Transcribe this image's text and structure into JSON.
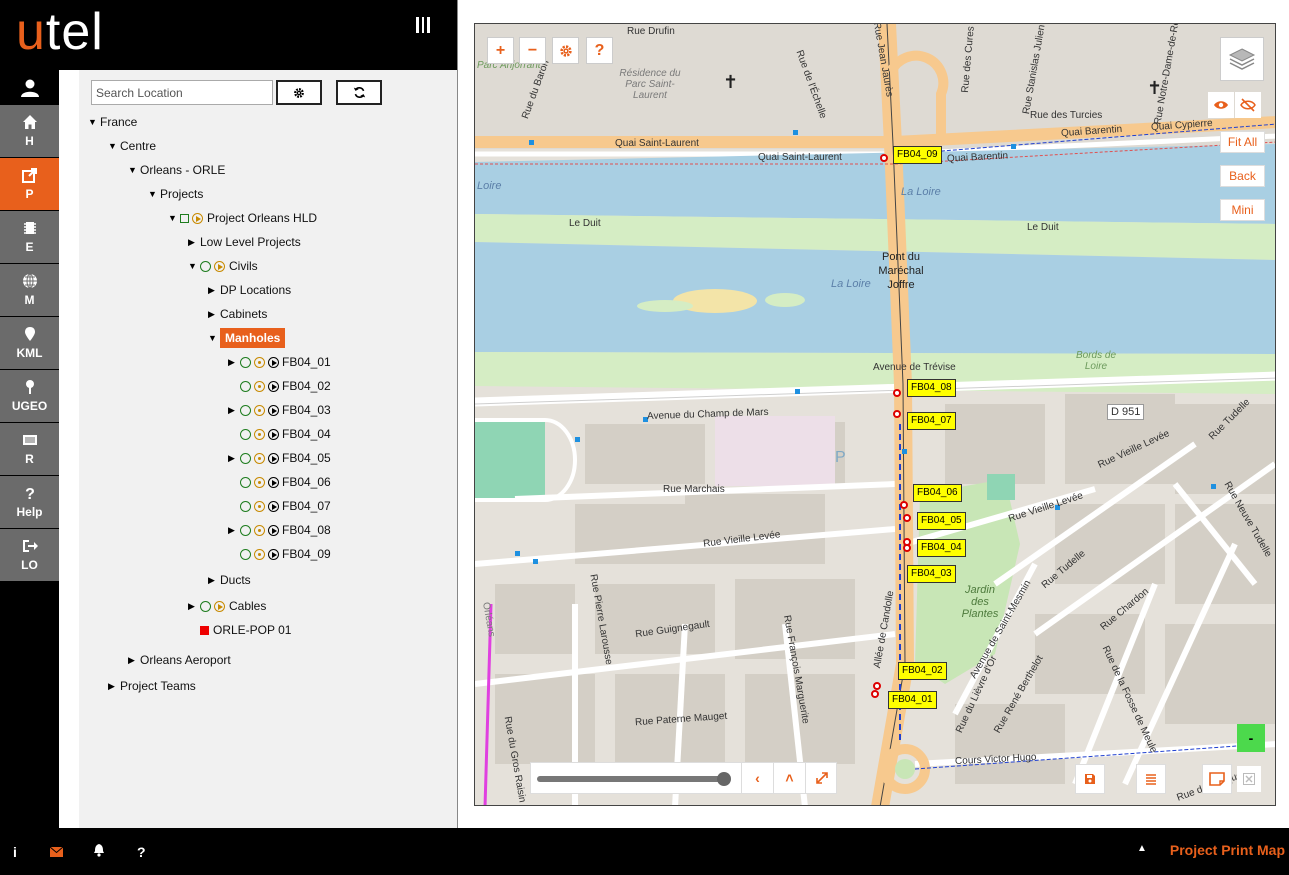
{
  "brand": {
    "logo_u": "u",
    "logo_rest": "tel"
  },
  "nav": {
    "items": [
      {
        "label": "H",
        "icon": "home-icon"
      },
      {
        "label": "P",
        "icon": "share-icon"
      },
      {
        "label": "E",
        "icon": "chip-icon"
      },
      {
        "label": "M",
        "icon": "globe-icon"
      },
      {
        "label": "KML",
        "icon": "pin-icon"
      },
      {
        "label": "UGEO",
        "icon": "map-pin-icon"
      },
      {
        "label": "R",
        "icon": "report-icon"
      },
      {
        "label": "Help",
        "icon": "help-icon"
      },
      {
        "label": "LO",
        "icon": "logout-icon"
      }
    ],
    "active": "P"
  },
  "search": {
    "placeholder": "Search Location"
  },
  "tree": {
    "france": "France",
    "centre": "Centre",
    "orleans_orle": "Orleans - ORLE",
    "projects": "Projects",
    "project_hld": "Project Orleans HLD",
    "low_level": "Low Level Projects",
    "civils": "Civils",
    "dp_locations": "DP Locations",
    "cabinets": "Cabinets",
    "manholes": "Manholes",
    "fb04_01": "FB04_01",
    "fb04_02": "FB04_02",
    "fb04_03": "FB04_03",
    "fb04_04": "FB04_04",
    "fb04_05": "FB04_05",
    "fb04_06": "FB04_06",
    "fb04_07": "FB04_07",
    "fb04_08": "FB04_08",
    "fb04_09": "FB04_09",
    "ducts": "Ducts",
    "cables": "Cables",
    "orle_pop": "ORLE-POP 01",
    "orleans_aeroport": "Orleans Aeroport",
    "project_teams": "Project Teams"
  },
  "map": {
    "controls": {
      "zoom_in": "+",
      "zoom_out": "−",
      "help": "?"
    },
    "right_buttons": {
      "fit_all": "Fit All",
      "back": "Back",
      "mini": "Mini"
    },
    "minus": "-",
    "labels": {
      "rue_drufin": "Rue Drufin",
      "rue_du_baron": "Rue du Baron",
      "parc_anjorrant": "Parc Anjorrant",
      "residence": "Résidence du Parc Saint-Laurent",
      "rue_de_lechelle": "Rue de l'Échelle",
      "rue_jean_jaures": "Rue Jean Jaurès",
      "rue_des_turcies": "Rue des Turcies",
      "rue_des_cures": "Rue des Cures",
      "rue_stanislas": "Rue Stanislas Julien",
      "rue_notre_dame": "Rue Notre-Dame-de-Recouvrance",
      "quai_barentin": "Quai Barentin",
      "quai_cypierre": "Quai Cypierre",
      "quai_saint_laurent": "Quai Saint-Laurent",
      "quai_saint_laurent2": "Quai Saint-Laurent",
      "quai_barentin2": "Quai Barentin",
      "loire": "Loire",
      "la_loire": "La Loire",
      "la_loire2": "La Loire",
      "le_duit": "Le Duit",
      "le_duit2": "Le Duit",
      "pont": "Pont du Maréchal Joffre",
      "bords_de_loire": "Bords de Loire",
      "avenue_trevise": "Avenue de Trévise",
      "avenue_champ_mars": "Avenue du Champ de Mars",
      "d951": "D 951",
      "rue_vieille_levee": "Rue Vieille Levée",
      "rue_tudelle": "Rue Tudelle",
      "rue_marchais": "Rue Marchais",
      "rue_vieille_levee2": "Rue Vieille Levée",
      "rue_vieille_levee3": "Rue Vieille Levée",
      "rue_guignegault": "Rue Guignegault",
      "rue_pierre_larousse": "Rue Pierre Larousse",
      "jardin_plantes": "Jardin des Plantes",
      "rue_tudelle2": "Rue Tudelle",
      "rue_chardon": "Rue Chardon",
      "rue_neuve_tudelle": "Rue Neuve Tudelle",
      "allee_candolle": "Allée de Candolle",
      "rue_paterne": "Rue Paterne Mauget",
      "rue_francois": "Rue François Marguerite",
      "rue_gros_raisin": "Rue du Gros Raisin",
      "cours_victor_hugo": "Cours Victor Hugo",
      "avenue_saint_mesmin": "Avenue de Saint-Mesmin",
      "rue_rene_berthelot": "Rue René Berthelot",
      "rue_fosse_meule": "Rue de la Fosse de Meule",
      "rue_lievre": "Rue du Lièvre d'Or",
      "orleans_side": "Orléans",
      "rue_vauquois": "Rue de Vauquois"
    },
    "manholes": {
      "fb04_09": "FB04_09",
      "fb04_08": "FB04_08",
      "fb04_07": "FB04_07",
      "fb04_06": "FB04_06",
      "fb04_05": "FB04_05",
      "fb04_04": "FB04_04",
      "fb04_03": "FB04_03",
      "fb04_02": "FB04_02",
      "fb04_01": "FB04_01"
    },
    "slider_fraction": 0.97
  },
  "footer": {
    "title": "Project Print Map"
  },
  "colors": {
    "accent": "#e8601c",
    "highlight": "#ffff00",
    "manhole": "#dd0000"
  }
}
